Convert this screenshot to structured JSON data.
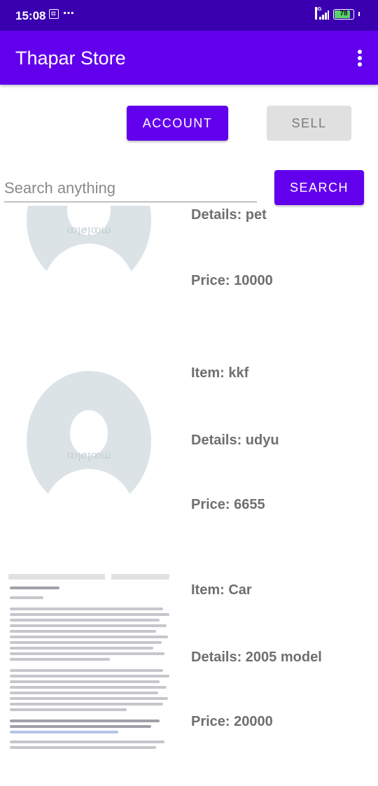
{
  "status_bar": {
    "time": "15:08",
    "more_icon": "⋯",
    "network": "4G",
    "battery": "78"
  },
  "app_bar": {
    "title": "Thapar Store",
    "menu_icon": "overflow-menu-icon"
  },
  "buttons": {
    "account": "ACCOUNT",
    "sell": "SELL",
    "search": "SEARCH"
  },
  "search": {
    "placeholder": "Search anything"
  },
  "items": [
    {
      "item": "",
      "details": "Details: pet",
      "price": "Price: 10000",
      "image": "placeholder-avatar"
    },
    {
      "item": "Item: kkf",
      "details": "Details: udyu",
      "price": "Price: 6655",
      "image": "placeholder-avatar"
    },
    {
      "item": "Item: Car",
      "details": "Details: 2005 model",
      "price": "Price: 20000",
      "image": "document-screenshot"
    }
  ],
  "colors": {
    "primary": "#6200ee",
    "status_bar": "#3a00b0",
    "text_gray": "#6f6f6f",
    "disabled_button": "#e0e0e0"
  }
}
